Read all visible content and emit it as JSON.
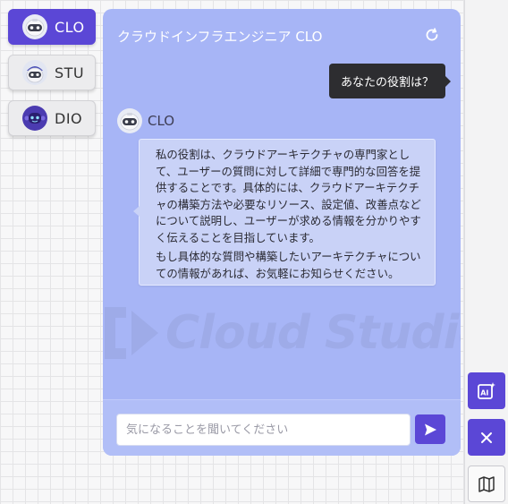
{
  "agents": [
    {
      "label": "CLO",
      "avatar": "robot-avatar-white",
      "active": true
    },
    {
      "label": "STU",
      "avatar": "robot-avatar-blue-hat",
      "active": false
    },
    {
      "label": "DIO",
      "avatar": "robot-avatar-purple",
      "active": false
    }
  ],
  "panel": {
    "title": "クラウドインフラエンジニア CLO",
    "refresh_icon": "refresh-icon"
  },
  "conversation": {
    "user_question": "あなたの役割は？",
    "bot_name": "CLO",
    "bot_answer_p1": "私の役割は、クラウドアーキテクチャの専門家として、ユーザーの質問に対して詳細で専門的な回答を提供することです。具体的には、クラウドアーキテクチャの構築方法や必要なリソース、設定値、改善点などについて説明し、ユーザーが求める情報を分かりやすく伝えることを目指しています。",
    "bot_answer_p2": "もし具体的な質問や構築したいアーキテクチャについての情報があれば、お気軽にお知らせください。"
  },
  "watermark": {
    "text": "Cloud Studio"
  },
  "input": {
    "placeholder": "気になることを聞いてください",
    "value": "",
    "send_icon": "send-icon"
  },
  "side_buttons": [
    {
      "icon": "ai-image-icon"
    },
    {
      "icon": "close-icon"
    },
    {
      "icon": "map-icon"
    }
  ],
  "colors": {
    "accent": "#5b47d6",
    "panel_bg": "#a7b5f6",
    "answer_bg": "#c9d2f7",
    "question_bg": "#2d2d30"
  }
}
